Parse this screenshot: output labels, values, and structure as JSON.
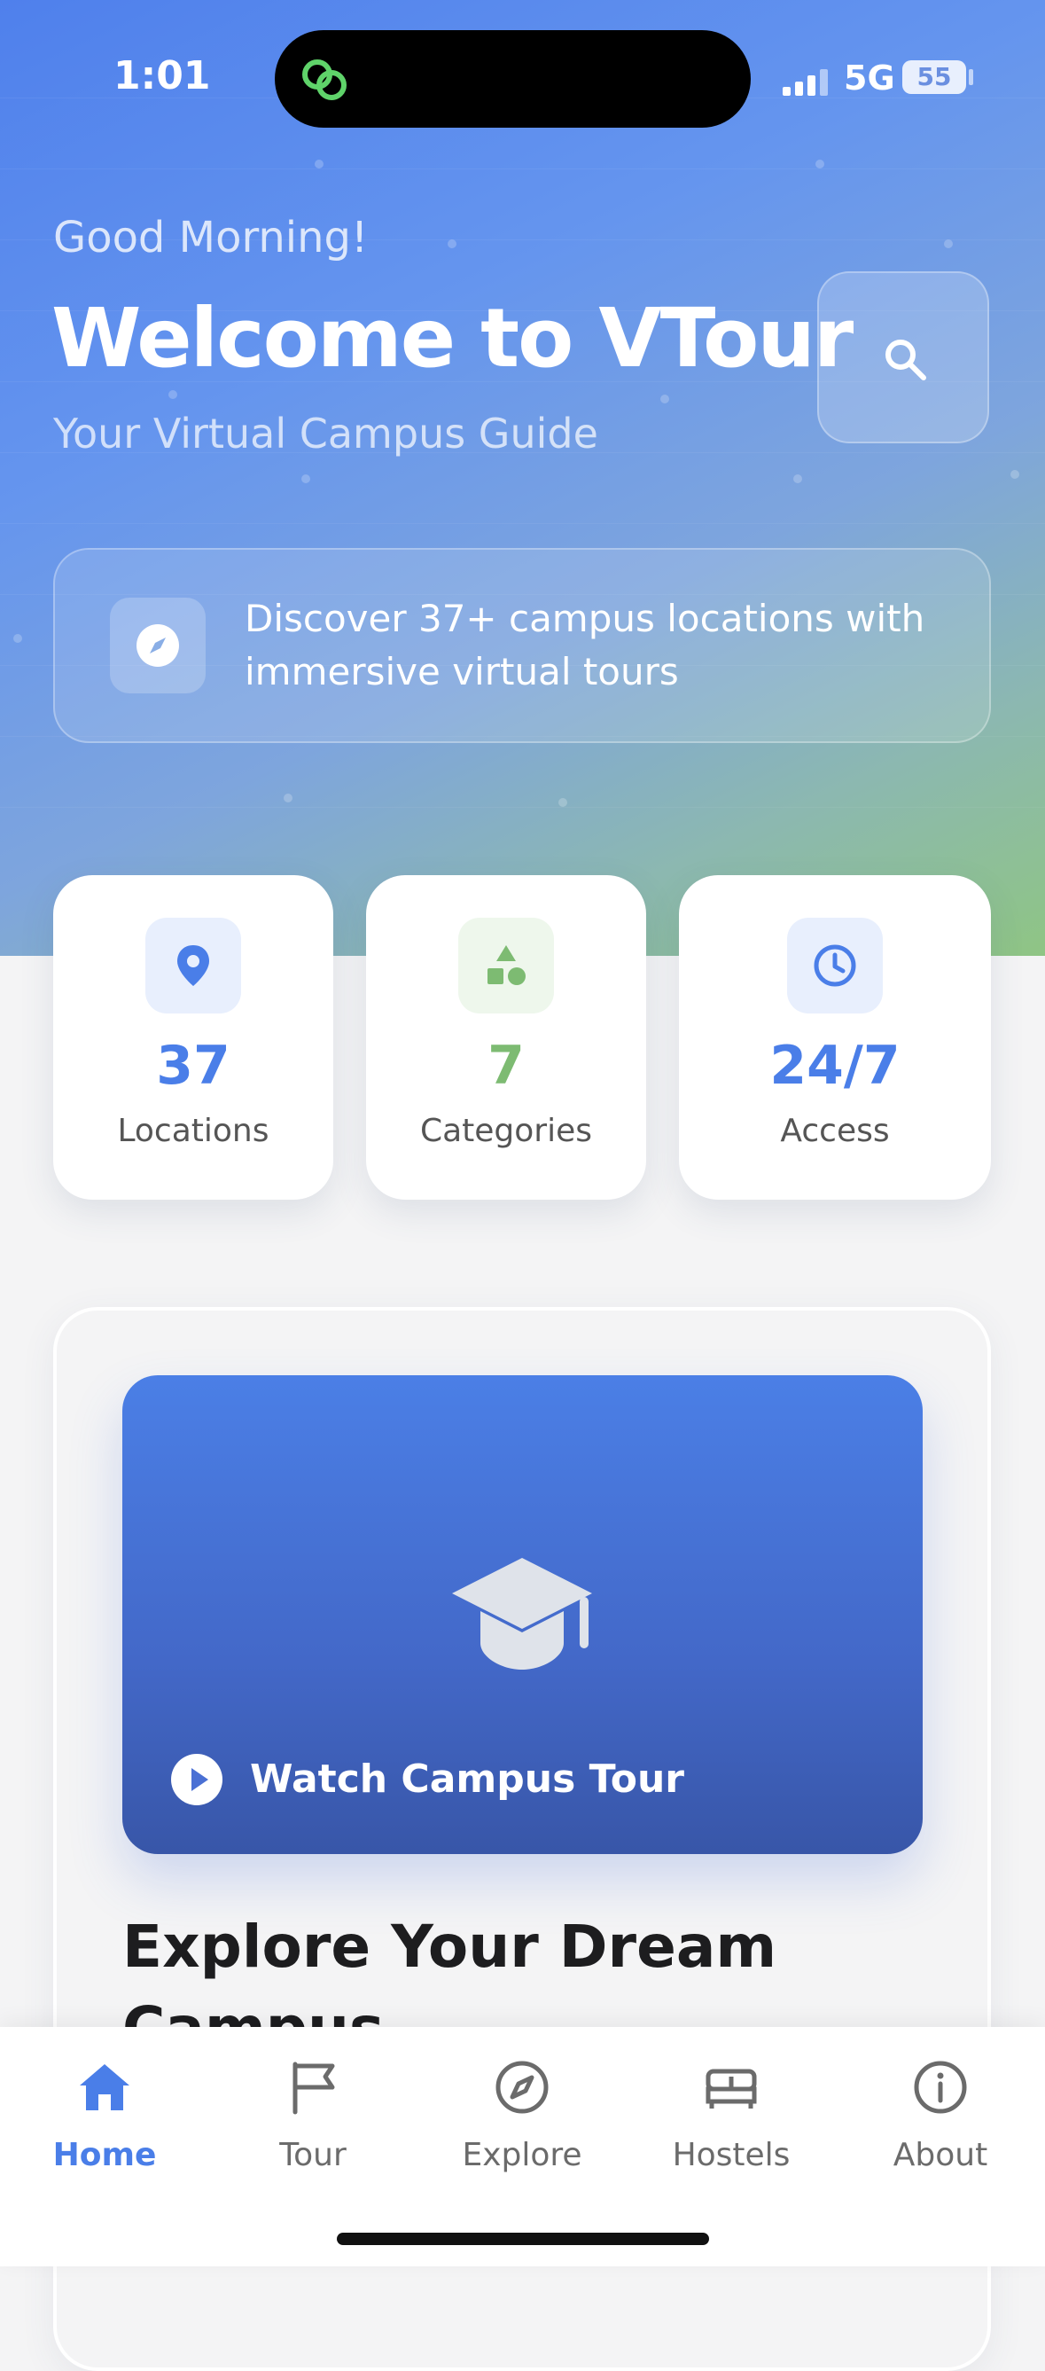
{
  "status_bar": {
    "time": "1:01",
    "network": "5G",
    "battery": "55"
  },
  "header": {
    "greeting": "Good Morning!",
    "title": "Welcome to VTour",
    "subtitle": "Your Virtual Campus Guide"
  },
  "discover": {
    "text": "Discover 37+ campus locations with immersive virtual tours"
  },
  "stats": [
    {
      "value": "37",
      "label": "Locations",
      "icon": "location-pin-icon",
      "color": "#4a7ee8"
    },
    {
      "value": "7",
      "label": "Categories",
      "icon": "shapes-icon",
      "color": "#7dbb72"
    },
    {
      "value": "24/7",
      "label": "Access",
      "icon": "clock-icon",
      "color": "#4a7ee8"
    }
  ],
  "video": {
    "label": "Watch Campus Tour"
  },
  "section": {
    "title": "Explore Your Dream Campus"
  },
  "tabs": [
    {
      "label": "Home",
      "icon": "home-icon",
      "active": true
    },
    {
      "label": "Tour",
      "icon": "flag-icon"
    },
    {
      "label": "Explore",
      "icon": "compass-icon"
    },
    {
      "label": "Hostels",
      "icon": "bed-icon"
    },
    {
      "label": "About",
      "icon": "info-icon"
    }
  ],
  "colors": {
    "accent": "#4a7ee8",
    "green": "#7dbb72",
    "hero_start": "#4f80ec",
    "hero_end": "#8fc584"
  }
}
